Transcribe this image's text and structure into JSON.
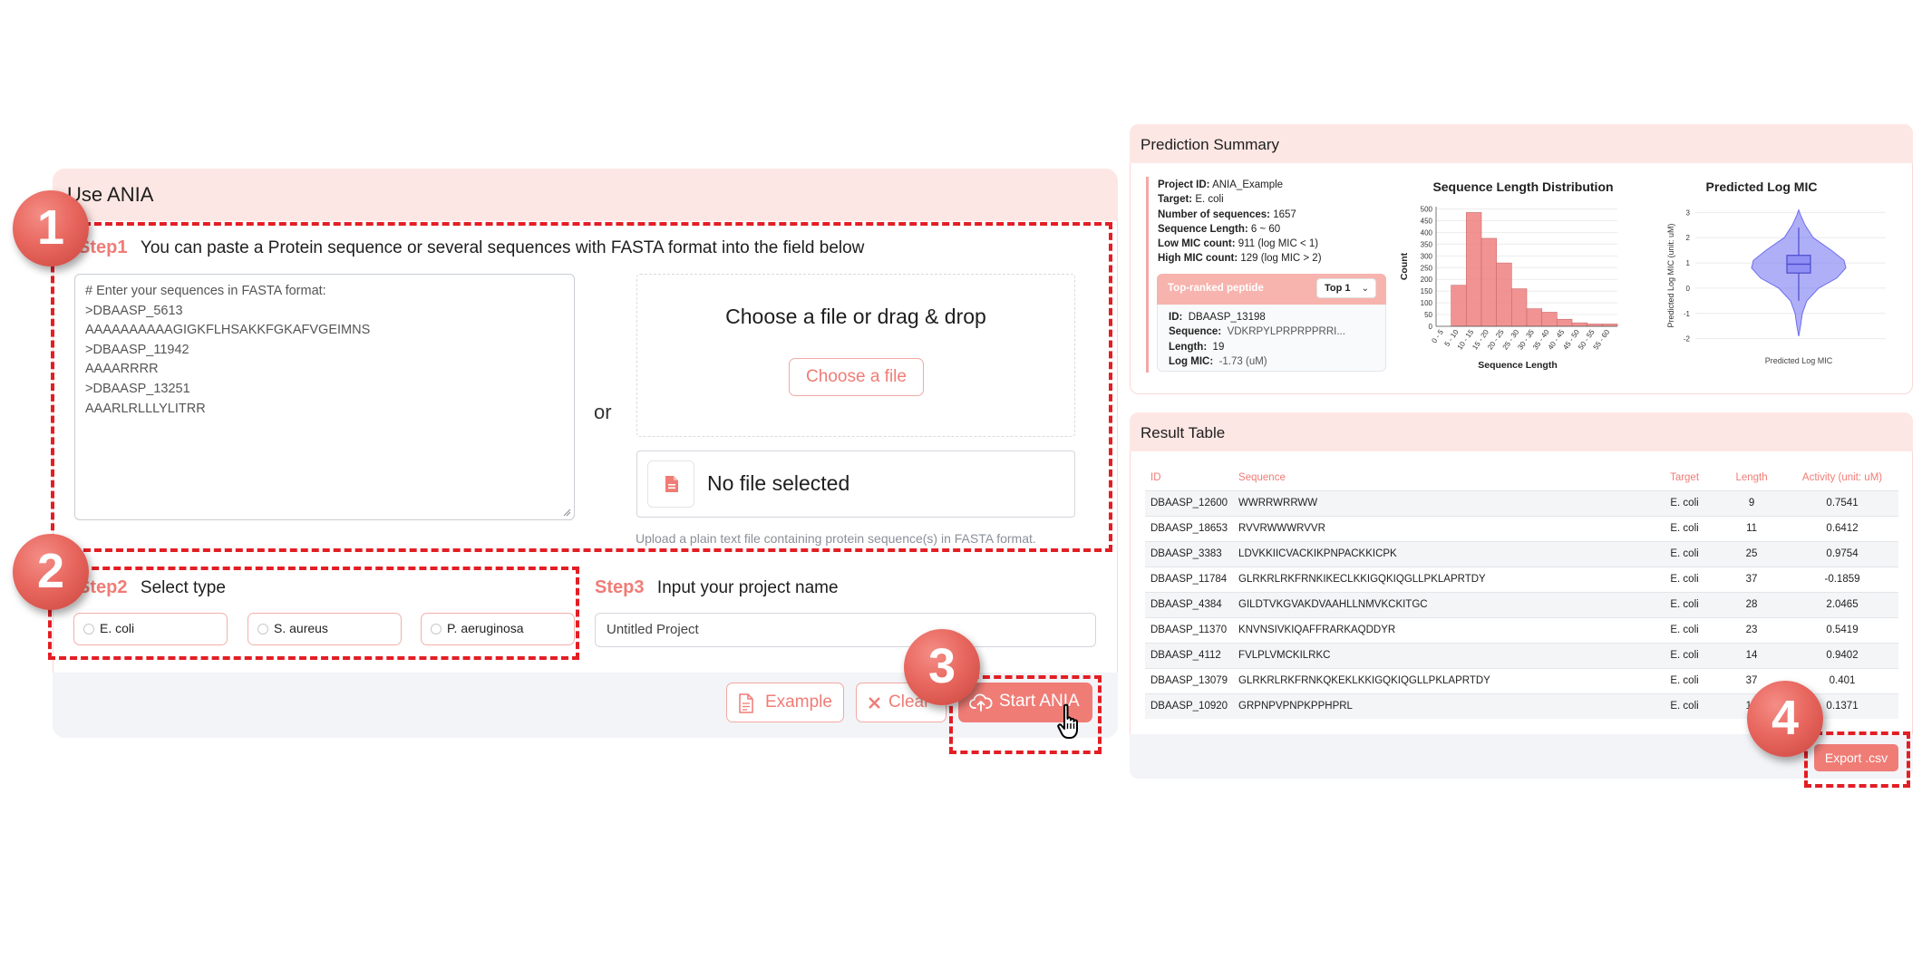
{
  "use_ania": {
    "title": "Use ANIA",
    "step1": {
      "label": "Step1",
      "text": "You can paste a Protein sequence or several sequences with FASTA format into the field below",
      "textarea_lines": [
        "# Enter your sequences in FASTA format:",
        ">DBAASP_5613",
        "AAAAAAAAAAGIGKFLHSAKKFGKAFVGEIMNS",
        ">DBAASP_11942",
        "AAAARRRR",
        ">DBAASP_13251",
        "AAARLRLLLYLITRR"
      ],
      "or": "or",
      "drop_title": "Choose a file or drag & drop",
      "choose_button": "Choose a file",
      "file_status": "No file selected",
      "upload_hint": "Upload a plain text file containing protein sequence(s) in FASTA format."
    },
    "step2": {
      "label": "Step2",
      "text": "Select type",
      "options": [
        "E. coli",
        "S. aureus",
        "P. aeruginosa"
      ]
    },
    "step3": {
      "label": "Step3",
      "text": "Input your project name",
      "value": "Untitled Project"
    },
    "buttons": {
      "example": "Example",
      "clear": "Clear",
      "start": "Start ANIA"
    }
  },
  "callouts": [
    "1",
    "2",
    "3",
    "4"
  ],
  "summary": {
    "title": "Prediction Summary",
    "info": [
      {
        "key": "Project ID:",
        "value": "ANIA_Example"
      },
      {
        "key": "Target:",
        "value": "E. coli"
      },
      {
        "key": "Number of sequences:",
        "value": "1657"
      },
      {
        "key": "Sequence Length:",
        "value": "6 ~ 60"
      },
      {
        "key": "Low MIC count:",
        "value": "911 (log MIC < 1)"
      },
      {
        "key": "High MIC count:",
        "value": "129 (log MIC > 2)"
      }
    ],
    "top_card": {
      "title": "Top-ranked peptide",
      "select": "Top 1",
      "rows": [
        {
          "key": "ID:",
          "value": "DBAASP_13198"
        },
        {
          "key": "Sequence:",
          "value": "VDKRPYLPRPRPPRRI..."
        },
        {
          "key": "Length:",
          "value": "19"
        },
        {
          "key": "Log MIC:",
          "value": "-1.73 (uM)"
        }
      ]
    }
  },
  "chart_data": [
    {
      "type": "bar",
      "title": "Sequence Length Distribution",
      "xlabel": "Sequence Length",
      "ylabel": "Count",
      "categories": [
        "0 - 5",
        "5 - 10",
        "10 - 15",
        "15 - 20",
        "20 - 25",
        "25 - 30",
        "30 - 35",
        "35 - 40",
        "40 - 45",
        "45 - 50",
        "50 - 55",
        "55 - 60"
      ],
      "values": [
        0,
        175,
        485,
        375,
        270,
        160,
        75,
        60,
        30,
        15,
        10,
        10
      ],
      "yticks": [
        0,
        50,
        100,
        150,
        200,
        250,
        300,
        350,
        400,
        450,
        500
      ],
      "ylim": [
        0,
        510
      ],
      "grid": true,
      "color": "#f08080"
    },
    {
      "type": "violin",
      "title": "Predicted Log MIC",
      "xlabel": "Predicted Log MIC",
      "ylabel": "Predicted Log MIC (unit: uM)",
      "yticks": [
        -2,
        -1,
        0,
        1,
        2,
        3
      ],
      "ylim": [
        -2.3,
        3.3
      ],
      "quartiles": {
        "q1": 0.6,
        "median": 0.95,
        "q3": 1.3,
        "whisker_low": -0.5,
        "whisker_high": 2.4
      },
      "range": [
        -1.9,
        3.1
      ],
      "grid": true,
      "color": "#6d6df0"
    }
  ],
  "results": {
    "title": "Result Table",
    "columns": [
      "ID",
      "Sequence",
      "Target",
      "Length",
      "Activity (unit: uM)"
    ],
    "rows": [
      [
        "DBAASP_12600",
        "WWRRWRRWW",
        "E. coli",
        "9",
        "0.7541"
      ],
      [
        "DBAASP_18653",
        "RVVRWWWRVVR",
        "E. coli",
        "11",
        "0.6412"
      ],
      [
        "DBAASP_3383",
        "LDVKKIICVACKIKPNPACKKICPK",
        "E. coli",
        "25",
        "0.9754"
      ],
      [
        "DBAASP_11784",
        "GLRKRLRKFRNKIKECLKKIGQKIQGLLPKLAPRTDY",
        "E. coli",
        "37",
        "-0.1859"
      ],
      [
        "DBAASP_4384",
        "GILDTVKGVAKDVAAHLLNMVKCKITGC",
        "E. coli",
        "28",
        "2.0465"
      ],
      [
        "DBAASP_11370",
        "KNVNSIVKIQAFFRARKAQDDYR",
        "E. coli",
        "23",
        "0.5419"
      ],
      [
        "DBAASP_4112",
        "FVLPLVMCKILRKC",
        "E. coli",
        "14",
        "0.9402"
      ],
      [
        "DBAASP_13079",
        "GLRKRLRKFRNKQKEKLKKIGQKIQGLLPKLAPRTDY",
        "E. coli",
        "37",
        "0.401"
      ],
      [
        "DBAASP_10920",
        "GRPNPVPNPKPPHPRL",
        "E. coli",
        "16",
        "0.1371"
      ]
    ],
    "export_button": "Export .csv"
  }
}
